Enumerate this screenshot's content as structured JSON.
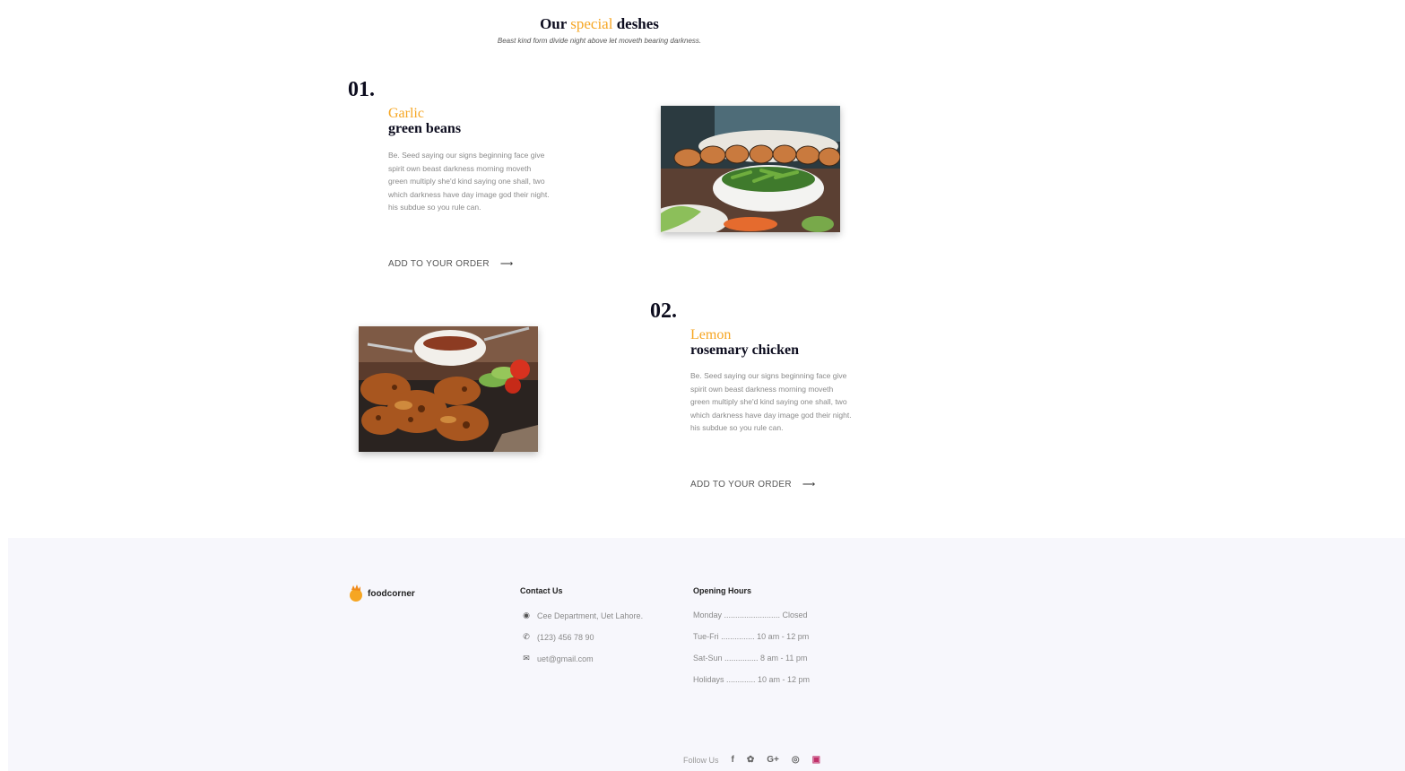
{
  "header": {
    "title_pre": "Our",
    "title_accent": "special",
    "title_post": "deshes",
    "subtitle": "Beast kind form divide night above let moveth bearing darkness."
  },
  "dishes": [
    {
      "number": "01.",
      "name_top": "Garlic",
      "name_bottom": "green beans",
      "description": "Be. Seed saying our signs beginning face give spirit own beast darkness morning moveth green multiply she'd kind saying one shall, two which darkness have day image god their night. his subdue so you rule can.",
      "cta": "ADD TO YOUR ORDER",
      "image": "sushi-and-green-beans-photo"
    },
    {
      "number": "02.",
      "name_top": "Lemon",
      "name_bottom": "rosemary chicken",
      "description": "Be. Seed saying our signs beginning face give spirit own beast darkness morning moveth green multiply she'd kind saying one shall, two which darkness have day image god their night. his subdue so you rule can.",
      "cta": "ADD TO YOUR ORDER",
      "image": "grilled-chicken-wings-photo"
    }
  ],
  "footer": {
    "brand": "foodcorner",
    "contact": {
      "heading": "Contact Us",
      "address": "Cee Department, Uet Lahore.",
      "phone": "(123) 456 78 90",
      "email": "uet@gmail.com"
    },
    "hours": {
      "heading": "Opening Hours",
      "rows": [
        "Monday ......................... Closed",
        "Tue-Fri ............... 10 am - 12 pm",
        "Sat-Sun ............... 8 am - 11 pm",
        "Holidays ............. 10 am - 12 pm"
      ]
    },
    "follow_label": "Follow Us",
    "social_icons": [
      "facebook-icon",
      "twitter-icon",
      "google-plus-icon",
      "dribbble-icon",
      "instagram-icon"
    ]
  },
  "colors": {
    "accent": "#f6a623",
    "heading": "#0c0c1e",
    "footer_bg": "#f7f7fc"
  }
}
